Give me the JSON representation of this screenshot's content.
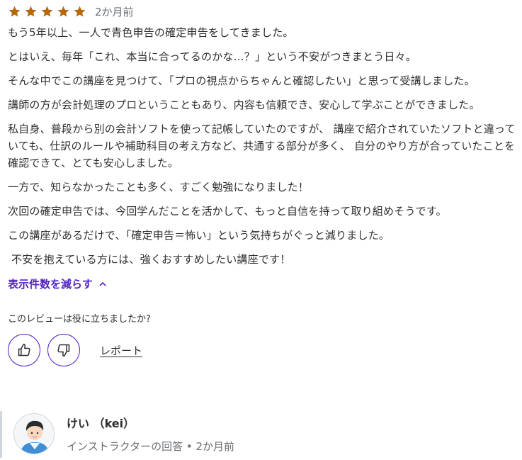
{
  "review": {
    "rating": 5,
    "star_color": "#b4690e",
    "time_ago": "2か月前",
    "paragraphs": [
      "もう5年以上、一人で青色申告の確定申告をしてきました。",
      "とはいえ、毎年「これ、本当に合ってるのかな…？」という不安がつきまとう日々。",
      "そんな中でこの講座を見つけて、「プロの視点からちゃんと確認したい」と思って受講しました。",
      "講師の方が会計処理のプロということもあり、内容も信頼でき、安心して学ぶことができました。",
      "私自身、普段から別の会計ソフトを使って記帳していたのですが、 講座で紹介されていたソフトと違っていても、仕訳のルールや補助科目の考え方など、共通する部分が多く、 自分のやり方が合っていたことを確認できて、とても安心しました。",
      "一方で、知らなかったことも多く、すごく勉強になりました！",
      "次回の確定申告では、今回学んだことを活かして、もっと自信を持って取り組めそうです。",
      "この講座があるだけで、「確定申告＝怖い」という気持ちがぐっと減りました。",
      " 不安を抱えている方には、強くおすすめしたい講座です！"
    ],
    "show_less_label": "表示件数を減らす",
    "accent_color": "#5022c3"
  },
  "helpful": {
    "question": "このレビューは役に立ちましたか?",
    "like_icon": "thumbs-up-icon",
    "dislike_icon": "thumbs-down-icon",
    "report_label": "レポート"
  },
  "reply": {
    "name": "けい （kei）",
    "meta": "インストラクターの回答 • 2か月前"
  }
}
